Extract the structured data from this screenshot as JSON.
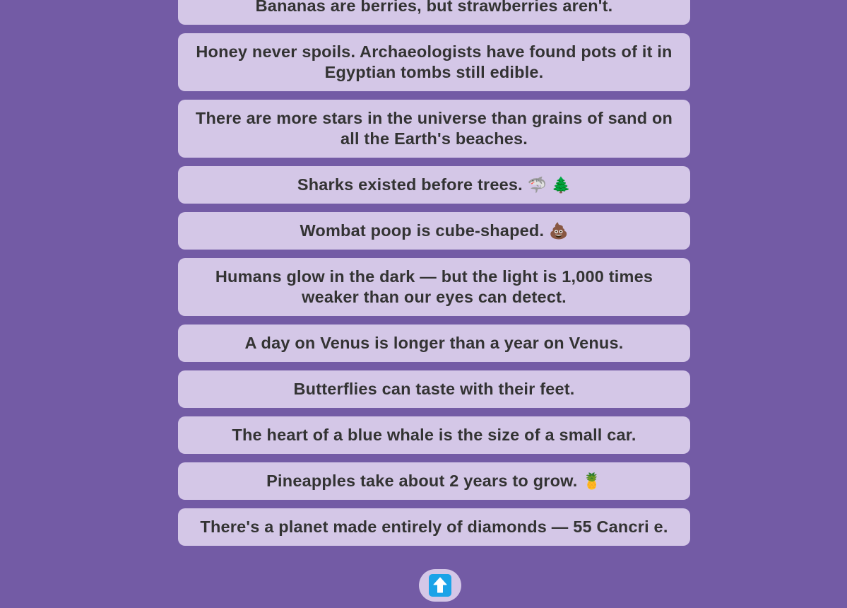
{
  "facts": [
    {
      "text": "Bananas are berries, but strawberries aren't.",
      "emoji": ""
    },
    {
      "text": "Honey never spoils. Archaeologists have found pots of it in Egyptian tombs still edible.",
      "emoji": ""
    },
    {
      "text": "There are more stars in the universe than grains of sand on all the Earth's beaches.",
      "emoji": ""
    },
    {
      "text": "Sharks existed before trees.",
      "emoji": "🦈 🌲"
    },
    {
      "text": "Wombat poop is cube-shaped.",
      "emoji": "💩"
    },
    {
      "text": "Humans glow in the dark — but the light is 1,000 times weaker than our eyes can detect.",
      "emoji": ""
    },
    {
      "text": "A day on Venus is longer than a year on Venus.",
      "emoji": ""
    },
    {
      "text": "Butterflies can taste with their feet.",
      "emoji": ""
    },
    {
      "text": "The heart of a blue whale is the size of a small car.",
      "emoji": ""
    },
    {
      "text": "Pineapples take about 2 years to grow.",
      "emoji": "🍍"
    },
    {
      "text": "There's a planet made entirely of diamonds — 55 Cancri e.",
      "emoji": ""
    }
  ],
  "scroll_top_button": {
    "icon": "up-arrow-icon"
  },
  "colors": {
    "background": "#735ba5",
    "card": "#d4c7e7",
    "text": "#333333",
    "accent": "#1aa3e8"
  }
}
